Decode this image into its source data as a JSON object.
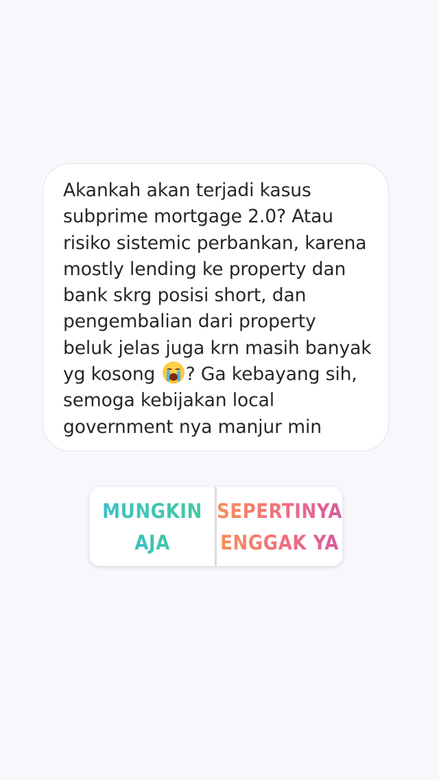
{
  "question": {
    "lines": [
      "Akankah akan terjadi kasus",
      "subprime mortgage 2.0? Atau",
      "risiko sistemic perbankan, karena",
      "mostly lending ke property dan",
      "bank skrg posisi short, dan",
      "pengembalian dari property",
      "beluk jelas juga krn masih banyak",
      "yg kosong",
      "? Ga kebayang sih,",
      "semoga kebijakan local",
      "government nya manjur min"
    ],
    "emoji": "loudly-crying-face-icon"
  },
  "poll": {
    "option_yes": {
      "line1": "MUNGKIN",
      "line2": "AJA"
    },
    "option_no": {
      "line1": "SEPERTINYA",
      "line2": "ENGGAK YA"
    },
    "colors": {
      "yes_gradient": [
        "#3cc1c7",
        "#45c8a3"
      ],
      "no_gradient": [
        "#f7915a",
        "#ef6b85",
        "#d35ea0"
      ]
    }
  },
  "colors": {
    "background": "#f8f7fc",
    "card": "#ffffff",
    "text": "#262626"
  }
}
